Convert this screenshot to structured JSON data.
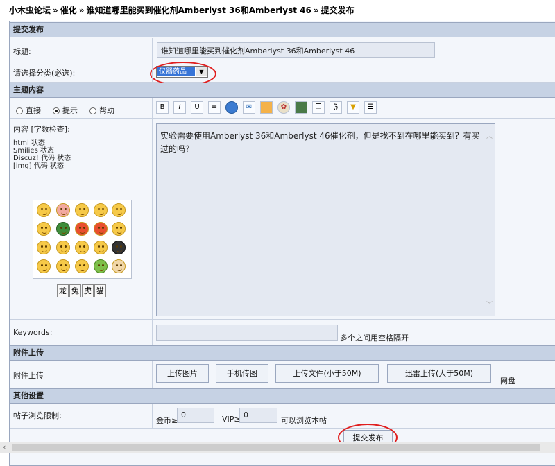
{
  "breadcrumb": {
    "forum": "小木虫论坛",
    "category": "催化",
    "thread": "谁知道哪里能买到催化剂Amberlyst 36和Amberlyst 46",
    "current": "提交发布"
  },
  "sections": {
    "submit": "提交发布",
    "topic_content": "主题内容",
    "attachments": "附件上传",
    "other": "其他设置"
  },
  "form": {
    "title_label": "标题:",
    "title_value": "谁知道哪里能买到催化剂Amberlyst 36和Amberlyst 46",
    "category_label": "请选择分类(必选):",
    "category_selected": "仪器药品",
    "modes": [
      "直接",
      "提示",
      "帮助"
    ],
    "content_label": "内容 [字数检查]:",
    "content_value": "实验需要使用Amberlyst 36和Amberlyst 46催化剂，但是找不到在哪里能买到？有买过的吗？",
    "status_lines": [
      "html 状态",
      "Smilies 状态",
      "Discuz! 代码 状态",
      "[img] 代码 状态"
    ],
    "zodiac": [
      "龙",
      "兔",
      "虎",
      "猫"
    ],
    "keywords_label": "Keywords:",
    "keywords_value": "",
    "keywords_hint": "多个之间用空格隔开",
    "attach_label": "附件上传",
    "attach_buttons": [
      "上传图片",
      "手机传图",
      "上传文件(小于50M)",
      "迅雷上传(大于50M)"
    ],
    "netdisk": "网盘",
    "view_limit_label": "帖子浏览限制:",
    "gold_label": "金币≥",
    "gold_value": "0",
    "vip_label": "VIP≥",
    "vip_value": "0",
    "view_suffix": "可以浏览本帖",
    "submit_button": "提交发布"
  },
  "toolbar_icons": [
    "bold-icon",
    "italic-icon",
    "underline-icon",
    "align-icon",
    "globe-link-icon",
    "email-icon",
    "image-icon",
    "media-icon",
    "film-icon",
    "quote-icon",
    "code-icon",
    "spoiler-icon",
    "list-icon"
  ],
  "colors": {
    "header_bg": "#c6d2e4",
    "row_bg": "#f3f6fb",
    "annotation": "#e01e1e"
  }
}
